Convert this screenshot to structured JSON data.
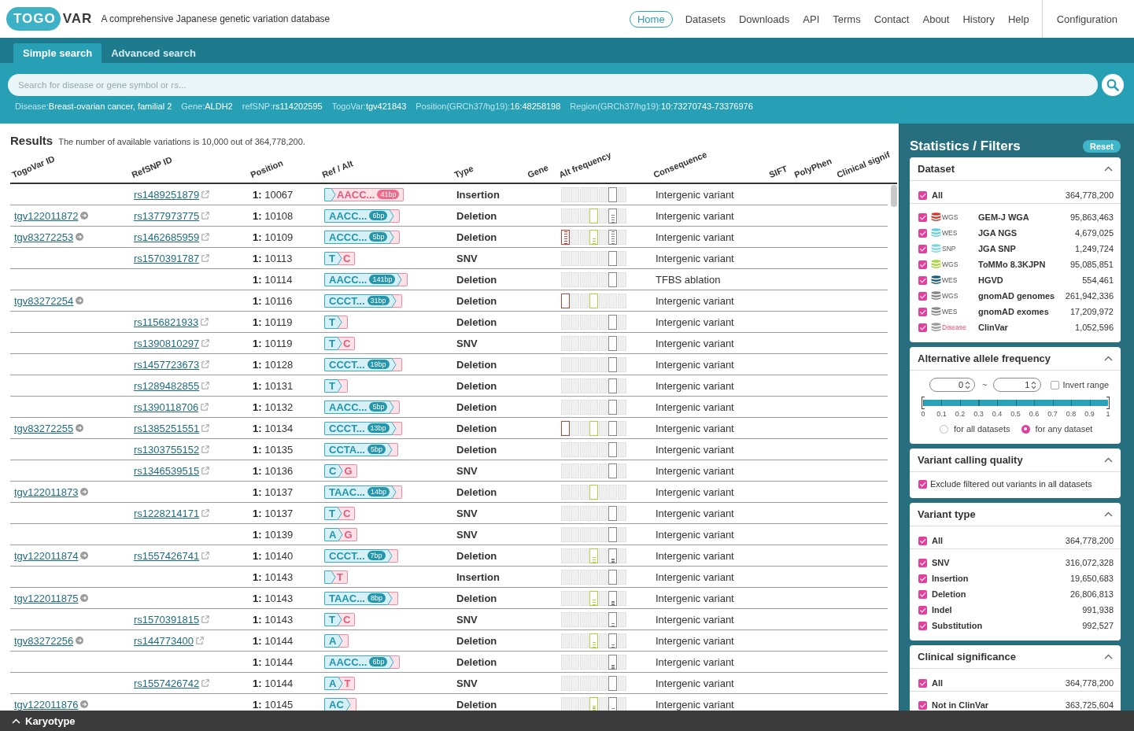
{
  "header": {
    "logo": {
      "badge": "TOGO",
      "text": "VAR"
    },
    "tagline": "A comprehensive Japanese genetic variation database",
    "nav": [
      {
        "label": "Home",
        "selected": true
      },
      {
        "label": "Datasets",
        "selected": false
      },
      {
        "label": "Downloads",
        "selected": false
      },
      {
        "label": "API",
        "selected": false
      },
      {
        "label": "Terms",
        "selected": false
      },
      {
        "label": "Contact",
        "selected": false
      },
      {
        "label": "About",
        "selected": false
      },
      {
        "label": "History",
        "selected": false
      },
      {
        "label": "Help",
        "selected": false
      }
    ],
    "config_link": "Configuration"
  },
  "search_tabs": [
    {
      "label": "Simple search",
      "selected": true
    },
    {
      "label": "Advanced search",
      "selected": false
    }
  ],
  "search": {
    "placeholder": "Search for disease or gene symbol or rs...",
    "examples": [
      {
        "label": "Disease:",
        "value": "Breast-ovarian cancer, familial 2"
      },
      {
        "label": "Gene:",
        "value": "ALDH2"
      },
      {
        "label": "refSNP:",
        "value": "rs114202595"
      },
      {
        "label": "TogoVar:",
        "value": "tgv421843"
      },
      {
        "label": "Position(GRCh37/hg19):",
        "value": "16:48258198"
      },
      {
        "label": "Region(GRCh37/hg19):",
        "value": "10:73270743-73376976"
      }
    ]
  },
  "results": {
    "title": "Results",
    "summary": "The number of available variations is 10,000 out of 364,778,200.",
    "columns": [
      "TogoVar ID",
      "RefSNP ID",
      "Position",
      "Ref / Alt",
      "Type",
      "Gene",
      "Alt frequency",
      "Consequence",
      "SIFT",
      "PolyPhen",
      "Clinical signif"
    ],
    "rows": [
      {
        "refsnp_id": "rs1489251879",
        "position": "**1:** 10067",
        "alt": "AACC...",
        "alt_length": "41bp",
        "type": "Insertion",
        "alt_frequency": [
          {
            "observed": false
          },
          {
            "observed": false
          },
          {
            "observed": false
          },
          {
            "observed": false
          },
          {
            "observed": false
          },
          {
            "observed": true
          },
          {
            "observed": false
          }
        ],
        "consequence": "Intergenic variant"
      },
      {
        "togovar_id": "tgv122011872",
        "refsnp_id": "rs1377973775",
        "position": "**1:** 10108",
        "ref": "AACC...",
        "ref_length": "6bp",
        "type": "Deletion",
        "alt_frequency": [
          {
            "observed": false
          },
          {
            "observed": false
          },
          {
            "observed": false
          },
          {
            "observed": true
          },
          {
            "observed": false
          },
          {
            "observed": true,
            "level": 0.6
          },
          {
            "observed": false
          }
        ],
        "consequence": "Intergenic variant"
      },
      {
        "togovar_id": "tgv83272253",
        "refsnp_id": "rs1462685959",
        "position": "**1:** 10109",
        "ref": "ACCC...",
        "ref_length": "5bp",
        "type": "Deletion",
        "alt_frequency": [
          {
            "observed": true,
            "level": 1
          },
          {
            "observed": false
          },
          {
            "observed": false
          },
          {
            "observed": true,
            "level": 0.4
          },
          {
            "observed": false
          },
          {
            "observed": true,
            "level": 0.9
          },
          {
            "observed": false
          }
        ],
        "consequence": "Intergenic variant"
      },
      {
        "refsnp_id": "rs1570391787",
        "position": "**1:** 10113",
        "ref": "T",
        "alt": "C",
        "type": "SNV",
        "alt_frequency": [
          {
            "observed": false
          },
          {
            "observed": false
          },
          {
            "observed": false
          },
          {
            "observed": false
          },
          {
            "observed": false
          },
          {
            "observed": true
          },
          {
            "observed": false
          }
        ],
        "consequence": "Intergenic variant"
      },
      {
        "position": "**1:** 10114",
        "ref": "AACC...",
        "ref_length": "141bp",
        "type": "Deletion",
        "alt_frequency": [
          {
            "observed": false
          },
          {
            "observed": false
          },
          {
            "observed": false
          },
          {
            "observed": false
          },
          {
            "observed": false
          },
          {
            "observed": true
          },
          {
            "observed": false
          }
        ],
        "consequence": "TFBS ablation"
      },
      {
        "togovar_id": "tgv83272254",
        "position": "**1:** 10116",
        "ref": "CCCT...",
        "ref_length": "31bp",
        "type": "Deletion",
        "alt_frequency": [
          {
            "observed": true
          },
          {
            "observed": false
          },
          {
            "observed": false
          },
          {
            "observed": true
          },
          {
            "observed": false
          },
          {
            "observed": false
          },
          {
            "observed": false
          }
        ],
        "consequence": "Intergenic variant"
      },
      {
        "refsnp_id": "rs1156821933",
        "position": "**1:** 10119",
        "ref": "T",
        "type": "Deletion",
        "alt_frequency": [
          {
            "observed": false
          },
          {
            "observed": false
          },
          {
            "observed": false
          },
          {
            "observed": false
          },
          {
            "observed": false
          },
          {
            "observed": true
          },
          {
            "observed": false
          }
        ],
        "consequence": "Intergenic variant"
      },
      {
        "refsnp_id": "rs1390810297",
        "position": "**1:** 10119",
        "ref": "T",
        "alt": "C",
        "type": "SNV",
        "alt_frequency": [
          {
            "observed": false
          },
          {
            "observed": false
          },
          {
            "observed": false
          },
          {
            "observed": false
          },
          {
            "observed": false
          },
          {
            "observed": true
          },
          {
            "observed": false
          }
        ],
        "consequence": "Intergenic variant"
      },
      {
        "refsnp_id": "rs1457723673",
        "position": "**1:** 10128",
        "ref": "CCCT...",
        "ref_length": "19bp",
        "type": "Deletion",
        "alt_frequency": [
          {
            "observed": false
          },
          {
            "observed": false
          },
          {
            "observed": false
          },
          {
            "observed": false
          },
          {
            "observed": false
          },
          {
            "observed": true
          },
          {
            "observed": false
          }
        ],
        "consequence": "Intergenic variant"
      },
      {
        "refsnp_id": "rs1289482855",
        "position": "**1:** 10131",
        "ref": "T",
        "type": "Deletion",
        "alt_frequency": [
          {
            "observed": false
          },
          {
            "observed": false
          },
          {
            "observed": false
          },
          {
            "observed": false
          },
          {
            "observed": false
          },
          {
            "observed": true
          },
          {
            "observed": false
          }
        ],
        "consequence": "Intergenic variant"
      },
      {
        "refsnp_id": "rs1390118706",
        "position": "**1:** 10132",
        "ref": "AACC...",
        "ref_length": "5bp",
        "type": "Deletion",
        "alt_frequency": [
          {
            "observed": false
          },
          {
            "observed": false
          },
          {
            "observed": false
          },
          {
            "observed": false
          },
          {
            "observed": false
          },
          {
            "observed": true
          },
          {
            "observed": false
          }
        ],
        "consequence": "Intergenic variant"
      },
      {
        "togovar_id": "tgv83272255",
        "refsnp_id": "rs1385251551",
        "position": "**1:** 10134",
        "ref": "CCCT...",
        "ref_length": "13bp",
        "type": "Deletion",
        "alt_frequency": [
          {
            "observed": true
          },
          {
            "observed": false
          },
          {
            "observed": false
          },
          {
            "observed": true
          },
          {
            "observed": false
          },
          {
            "observed": true
          },
          {
            "observed": false
          }
        ],
        "consequence": "Intergenic variant"
      },
      {
        "refsnp_id": "rs1303755152",
        "position": "**1:** 10135",
        "ref": "CCTA...",
        "ref_length": "5bp",
        "type": "Deletion",
        "alt_frequency": [
          {
            "observed": false
          },
          {
            "observed": false
          },
          {
            "observed": false
          },
          {
            "observed": false
          },
          {
            "observed": false
          },
          {
            "observed": true
          },
          {
            "observed": false
          }
        ],
        "consequence": "Intergenic variant"
      },
      {
        "refsnp_id": "rs1346539515",
        "position": "**1:** 10136",
        "ref": "C",
        "alt": "G",
        "type": "SNV",
        "alt_frequency": [
          {
            "observed": false
          },
          {
            "observed": false
          },
          {
            "observed": false
          },
          {
            "observed": false
          },
          {
            "observed": false
          },
          {
            "observed": true
          },
          {
            "observed": false
          }
        ],
        "consequence": "Intergenic variant"
      },
      {
        "togovar_id": "tgv122011873",
        "position": "**1:** 10137",
        "ref": "TAAC...",
        "ref_length": "14bp",
        "type": "Deletion",
        "alt_frequency": [
          {
            "observed": false
          },
          {
            "observed": false
          },
          {
            "observed": false
          },
          {
            "observed": true
          },
          {
            "observed": false
          },
          {
            "observed": false
          },
          {
            "observed": false
          }
        ],
        "consequence": "Intergenic variant"
      },
      {
        "refsnp_id": "rs1228214171",
        "position": "**1:** 10137",
        "ref": "T",
        "alt": "C",
        "type": "SNV",
        "alt_frequency": [
          {
            "observed": false
          },
          {
            "observed": false
          },
          {
            "observed": false
          },
          {
            "observed": false
          },
          {
            "observed": false
          },
          {
            "observed": true
          },
          {
            "observed": false
          }
        ],
        "consequence": "Intergenic variant"
      },
      {
        "position": "**1:** 10139",
        "ref": "A",
        "alt": "G",
        "type": "SNV",
        "alt_frequency": [
          {
            "observed": false
          },
          {
            "observed": false
          },
          {
            "observed": false
          },
          {
            "observed": false
          },
          {
            "observed": false
          },
          {
            "observed": true
          },
          {
            "observed": false
          }
        ],
        "consequence": "Intergenic variant"
      },
      {
        "togovar_id": "tgv122011874",
        "refsnp_id": "rs1557426741",
        "position": "**1:** 10140",
        "ref": "CCCT...",
        "ref_length": "7bp",
        "type": "Deletion",
        "alt_frequency": [
          {
            "observed": false
          },
          {
            "observed": false
          },
          {
            "observed": false
          },
          {
            "observed": true,
            "level": 0.4
          },
          {
            "observed": false
          },
          {
            "observed": true,
            "level": 0.3
          },
          {
            "observed": false
          }
        ],
        "consequence": "Intergenic variant"
      },
      {
        "position": "**1:** 10143",
        "alt": "T",
        "type": "Insertion",
        "alt_frequency": [
          {
            "observed": false
          },
          {
            "observed": false
          },
          {
            "observed": false
          },
          {
            "observed": false
          },
          {
            "observed": false
          },
          {
            "observed": true
          },
          {
            "observed": false
          }
        ],
        "consequence": "Intergenic variant"
      },
      {
        "togovar_id": "tgv122011875",
        "position": "**1:** 10143",
        "ref": "TAAC...",
        "ref_length": "8bp",
        "type": "Deletion",
        "alt_frequency": [
          {
            "observed": false
          },
          {
            "observed": false
          },
          {
            "observed": false
          },
          {
            "observed": true,
            "level": 0.4
          },
          {
            "observed": false
          },
          {
            "observed": true,
            "level": 0.3
          },
          {
            "observed": false
          }
        ],
        "consequence": "Intergenic variant"
      },
      {
        "refsnp_id": "rs1570391815",
        "position": "**1:** 10143",
        "ref": "T",
        "alt": "C",
        "type": "SNV",
        "alt_frequency": [
          {
            "observed": false
          },
          {
            "observed": false
          },
          {
            "observed": false
          },
          {
            "observed": false
          },
          {
            "observed": false
          },
          {
            "observed": true,
            "level": 0.3
          },
          {
            "observed": false
          }
        ],
        "consequence": "Intergenic variant"
      },
      {
        "togovar_id": "tgv83272256",
        "refsnp_id": "rs144773400",
        "position": "**1:** 10144",
        "ref": "A",
        "type": "Deletion",
        "alt_frequency": [
          {
            "observed": false
          },
          {
            "observed": false
          },
          {
            "observed": false
          },
          {
            "observed": true,
            "level": 0.4
          },
          {
            "observed": false
          },
          {
            "observed": true,
            "level": 0.3
          },
          {
            "observed": false
          }
        ],
        "consequence": "Intergenic variant"
      },
      {
        "position": "**1:** 10144",
        "ref": "AACC...",
        "ref_length": "6bp",
        "type": "Deletion",
        "alt_frequency": [
          {
            "observed": false
          },
          {
            "observed": false
          },
          {
            "observed": false
          },
          {
            "observed": false
          },
          {
            "observed": false
          },
          {
            "observed": true,
            "level": 0.3
          },
          {
            "observed": false
          }
        ],
        "consequence": "Intergenic variant"
      },
      {
        "refsnp_id": "rs1557426742",
        "position": "**1:** 10144",
        "ref": "A",
        "alt": "T",
        "type": "SNV",
        "alt_frequency": [
          {
            "observed": false
          },
          {
            "observed": false
          },
          {
            "observed": false
          },
          {
            "observed": false
          },
          {
            "observed": false
          },
          {
            "observed": true
          },
          {
            "observed": false
          }
        ],
        "consequence": "Intergenic variant"
      },
      {
        "togovar_id": "tgv122011876",
        "position": "**1:** 10145",
        "ref": "AC",
        "type": "Deletion",
        "alt_frequency": [
          {
            "observed": false
          },
          {
            "observed": false
          },
          {
            "observed": false
          },
          {
            "observed": true,
            "level": 0.4
          },
          {
            "observed": false
          },
          {
            "observed": true,
            "level": 0.3
          },
          {
            "observed": false
          }
        ],
        "consequence": "Intergenic variant"
      }
    ]
  },
  "sidebar": {
    "title": "Statistics / Filters",
    "reset": "Reset",
    "dataset": {
      "title": "Dataset",
      "expanded": true,
      "all": {
        "label": "All",
        "count": "364,778,200",
        "checked": true
      },
      "items": [
        {
          "tag": "WGS",
          "kind": "frequency",
          "color": "#d5392e",
          "name": "GEM-J WGA",
          "count": "95,863,463",
          "checked": true
        },
        {
          "tag": "WES",
          "kind": "frequency",
          "color": "#62cfe0",
          "name": "JGA NGS",
          "count": "4,679,025",
          "checked": true
        },
        {
          "tag": "SNP",
          "kind": "frequency",
          "color": "#7dd5df",
          "name": "JGA SNP",
          "count": "1,249,724",
          "checked": true
        },
        {
          "tag": "WGS",
          "kind": "frequency",
          "color": "#a6d53b",
          "name": "ToMMo 8.3KJPN",
          "count": "95,085,851",
          "checked": true
        },
        {
          "tag": "WES",
          "kind": "frequency",
          "color": "#1b5b7c",
          "name": "HGVD",
          "count": "554,461",
          "checked": true
        },
        {
          "tag": "WGS",
          "kind": "frequency",
          "color": "#858585",
          "name": "gnomAD genomes",
          "count": "261,942,336",
          "checked": true
        },
        {
          "tag": "WES",
          "kind": "frequency",
          "color": "#8a8a8a",
          "name": "gnomAD exomes",
          "count": "17,209,972",
          "checked": true
        },
        {
          "tag": "Disease",
          "kind": "clinical",
          "color": "#9b9b9b",
          "name": "ClinVar",
          "count": "1,052,596",
          "checked": true
        }
      ]
    },
    "allele_frequency": {
      "title": "Alternative allele frequency",
      "expanded": true,
      "from": "0",
      "separator": "~",
      "to": "1",
      "invert": {
        "label": "Invert range",
        "checked": false
      },
      "range": {
        "low": {
          "level": 0
        },
        "high": {
          "level": 1
        }
      },
      "ticks": [
        "0",
        "0.1",
        "0.2",
        "0.3",
        "0.4",
        "0.5",
        "0.6",
        "0.7",
        "0.8",
        "0.9",
        "1"
      ],
      "modes": [
        {
          "label": "for all datasets",
          "selected": false
        },
        {
          "label": "for any dataset",
          "selected": true
        }
      ]
    },
    "calling_quality": {
      "title": "Variant calling quality",
      "expanded": true,
      "options": [
        {
          "label": "Exclude filtered out variants in all datasets",
          "checked": true
        }
      ]
    },
    "variant_type": {
      "title": "Variant type",
      "expanded": true,
      "all": {
        "label": "All",
        "count": "364,778,200",
        "checked": true
      },
      "items": [
        {
          "label": "SNV",
          "count": "316,072,328",
          "checked": true
        },
        {
          "label": "Insertion",
          "count": "19,650,683",
          "checked": true
        },
        {
          "label": "Deletion",
          "count": "26,806,813",
          "checked": true
        },
        {
          "label": "Indel",
          "count": "991,938",
          "checked": true
        },
        {
          "label": "Substitution",
          "count": "992,527",
          "checked": true
        }
      ]
    },
    "clinical_significance": {
      "title": "Clinical significance",
      "expanded": true,
      "all": {
        "label": "All",
        "count": "364,778,200",
        "checked": true
      },
      "items": [
        {
          "label": "Not in ClinVar",
          "count": "363,725,604",
          "checked": true
        }
      ]
    }
  },
  "karyotype_bar": {
    "label": "Karyotype",
    "expanded": false
  }
}
